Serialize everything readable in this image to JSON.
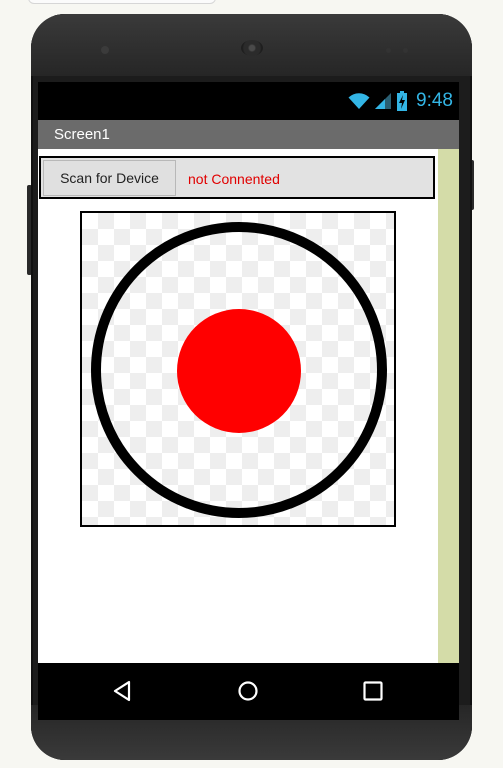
{
  "status_bar": {
    "time": "9:48"
  },
  "screen": {
    "title": "Screen1"
  },
  "controls": {
    "scan_button_label": "Scan for Device",
    "connection_status": "not Connented"
  },
  "colors": {
    "status_text": "#e10000",
    "ball": "#ff0000",
    "clock": "#33b5e5",
    "title_bar": "#6b6b6b",
    "scroll_strip": "#d4dca8"
  },
  "icons": [
    "wifi-icon",
    "signal-icon",
    "battery-icon",
    "back-icon",
    "home-icon",
    "recents-icon"
  ]
}
